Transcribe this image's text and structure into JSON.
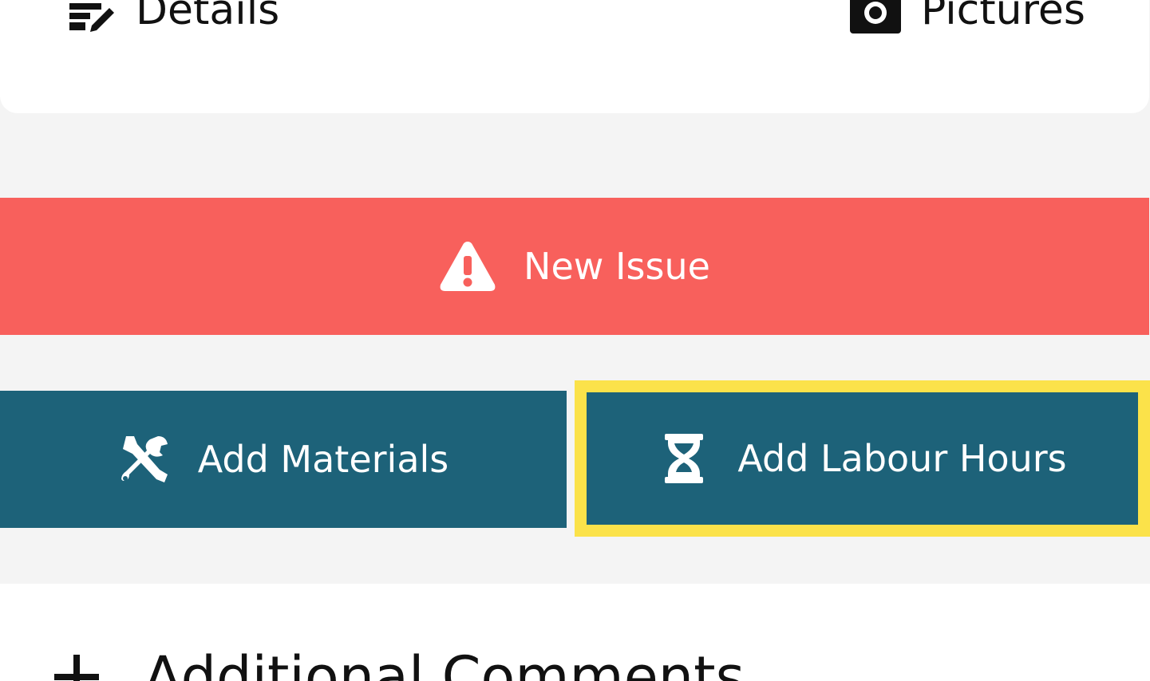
{
  "tabs": {
    "details_label": "Details",
    "details_icon": "edit-note-icon",
    "pictures_label": "Pictures",
    "pictures_icon": "camera-icon"
  },
  "new_issue": {
    "label": "New Issue",
    "icon": "warning-icon",
    "color": "#f8605c"
  },
  "actions": {
    "materials_label": "Add Materials",
    "materials_icon": "tools-icon",
    "labour_label": "Add Labour Hours",
    "labour_icon": "hourglass-icon",
    "button_color": "#1d6279",
    "highlight_color": "#fbe24a"
  },
  "comments": {
    "label": "Additional Comments",
    "icon": "plus-icon"
  }
}
